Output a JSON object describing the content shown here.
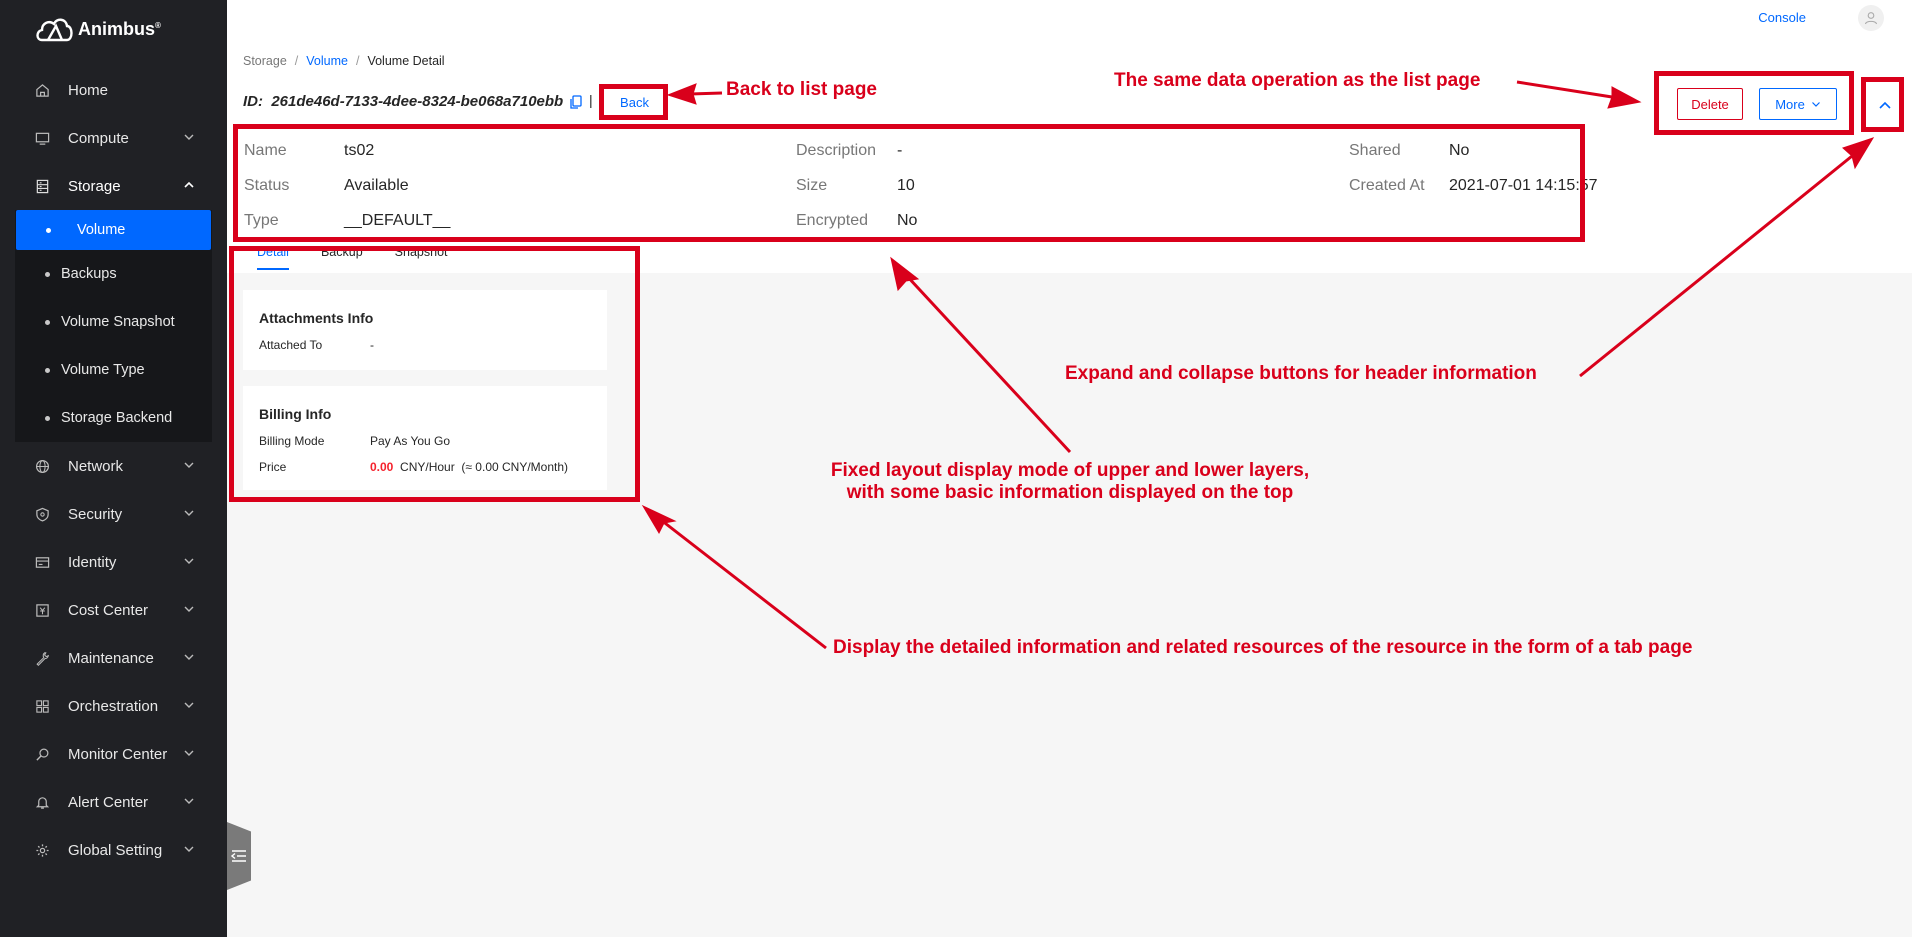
{
  "app": {
    "brand": "Animbus",
    "brand_mark": "®"
  },
  "topbar": {
    "console_label": "Console"
  },
  "sidebar": {
    "items": [
      {
        "label": "Home",
        "icon": "home-icon"
      },
      {
        "label": "Compute",
        "icon": "monitor-icon"
      },
      {
        "label": "Storage",
        "icon": "storage-icon",
        "expanded": true,
        "children": [
          "Volume",
          "Backups",
          "Volume Snapshot",
          "Volume Type",
          "Storage Backend"
        ],
        "active_child": "Volume"
      },
      {
        "label": "Network",
        "icon": "globe-icon"
      },
      {
        "label": "Security",
        "icon": "shield-icon"
      },
      {
        "label": "Identity",
        "icon": "id-card-icon"
      },
      {
        "label": "Cost Center",
        "icon": "cost-icon"
      },
      {
        "label": "Maintenance",
        "icon": "wrench-icon"
      },
      {
        "label": "Orchestration",
        "icon": "grid-icon"
      },
      {
        "label": "Monitor Center",
        "icon": "monitor-search-icon"
      },
      {
        "label": "Alert Center",
        "icon": "bell-icon"
      },
      {
        "label": "Global Setting",
        "icon": "gear-icon"
      }
    ]
  },
  "breadcrumb": {
    "root": "Storage",
    "parent": "Volume",
    "current": "Volume Detail"
  },
  "detail": {
    "id_label": "ID:",
    "id_value": "261de46d-7133-4dee-8324-be068a710ebb",
    "pipe": "|",
    "back_label": "Back",
    "delete_label": "Delete",
    "more_label": "More",
    "fields": {
      "name_label": "Name",
      "name_value": "ts02",
      "description_label": "Description",
      "description_value": "-",
      "shared_label": "Shared",
      "shared_value": "No",
      "status_label": "Status",
      "status_value": "Available",
      "size_label": "Size",
      "size_value": "10",
      "created_label": "Created At",
      "created_value": "2021-07-01 14:15:57",
      "type_label": "Type",
      "type_value": "__DEFAULT__",
      "encrypted_label": "Encrypted",
      "encrypted_value": "No"
    }
  },
  "tabs": [
    "Detail",
    "Backup",
    "Snapshot"
  ],
  "cards": {
    "attachments": {
      "title": "Attachments Info",
      "attached_label": "Attached To",
      "attached_value": "-"
    },
    "billing": {
      "title": "Billing Info",
      "mode_label": "Billing Mode",
      "mode_value": "Pay As You Go",
      "price_label": "Price",
      "price_num": "0.00",
      "price_unit": "CNY/Hour",
      "price_month": "(≈ 0.00 CNY/Month)"
    }
  },
  "annotations": {
    "back": "Back to list page",
    "ops": "The same data operation as the list page",
    "expand": "Expand and collapse buttons for header information",
    "fixed_1": "Fixed layout display mode of upper and lower layers,",
    "fixed_2": "with some basic information displayed on the top",
    "tabs": "Display the detailed information and related resources of the resource in the form of a tab page"
  },
  "colors": {
    "primary": "#0068ff",
    "danger": "#d9001b",
    "sidebar": "#202125"
  }
}
